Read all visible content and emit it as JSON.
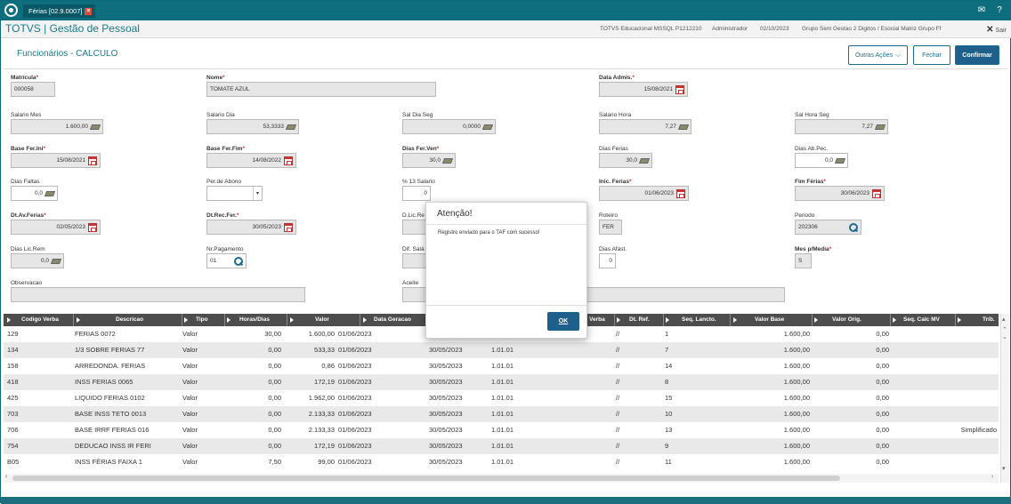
{
  "titlebar": {
    "tab_label": "Férias [02.9.0007]",
    "tab_close": "×",
    "mail_icon": "✉",
    "help_icon": "?"
  },
  "header": {
    "brand": "TOTVS | Gestão de Pessoal",
    "environment": "TOTVS Educacional MSSQL P1212210",
    "user": "Administrador",
    "date": "02/10/2023",
    "company": "Grupo Sem Gestao 2 Digitos / Esocial Matriz Grupo Ff",
    "exit_label": "Sair",
    "exit_icon": "✕"
  },
  "page": {
    "title": "Funcionários - CALCULO",
    "other_actions": "Outras Ações",
    "close": "Fechar",
    "confirm": "Confirmar"
  },
  "form": {
    "matricula": {
      "label": "Matrícula",
      "value": "000058"
    },
    "nome": {
      "label": "Nome",
      "value": "TOMATE AZUL"
    },
    "data_adms": {
      "label": "Data Admis.",
      "value": "15/08/2021"
    },
    "salario_mes": {
      "label": "Salario Mes",
      "value": "1.600,00"
    },
    "salario_dia": {
      "label": "Salario Dia",
      "value": "53,3333"
    },
    "sal_dia_seg": {
      "label": "Sal Dia Seg",
      "value": "0,0000"
    },
    "salario_hora": {
      "label": "Salario Hora",
      "value": "7,27"
    },
    "sal_hora_seg": {
      "label": "Sal Hora Seg",
      "value": "7,27"
    },
    "base_fer_ini": {
      "label": "Base Fer.Ini",
      "value": "15/08/2021"
    },
    "base_fer_fim": {
      "label": "Base Fer.Fim",
      "value": "14/08/2022"
    },
    "dias_fer_ven": {
      "label": "Dias Fer.Ven",
      "value": "30,0"
    },
    "dias_ferias": {
      "label": "Dias Ferias",
      "value": "30,0"
    },
    "dias_ab_pec": {
      "label": "Dias Ab.Pec.",
      "value": "0,0"
    },
    "dias_faltas": {
      "label": "Dias Faltas",
      "value": "0,0"
    },
    "per_abono": {
      "label": "Per.de Abono",
      "value": ""
    },
    "pct_13_salario": {
      "label": "% 13 Salario",
      "value": "0"
    },
    "inic_ferias": {
      "label": "Inic. Ferias",
      "value": "01/06/2023"
    },
    "fim_ferias": {
      "label": "Fim  Férias",
      "value": "30/06/2023"
    },
    "dt_av_ferias": {
      "label": "Dt.Av.Ferias",
      "value": "02/05/2023"
    },
    "dt_rec_fer": {
      "label": "Dt.Rec.Fer.",
      "value": "30/05/2023"
    },
    "d_lic_re": {
      "label": "D.Lic.Re"
    },
    "roteiro": {
      "label": "Roteiro",
      "value": "FER"
    },
    "periodo": {
      "label": "Periodo",
      "value": "202306"
    },
    "dias_lic_rem": {
      "label": "Dias Lic.Rem",
      "value": "0,0"
    },
    "nr_pagamento": {
      "label": "Nr.Pagamento",
      "value": "01"
    },
    "dif_sal": {
      "label": "Dif. Salá"
    },
    "dias_afast": {
      "label": "Dias Afast.",
      "value": "0"
    },
    "mes_p_media": {
      "label": "Mes p/Media",
      "value": "S"
    },
    "observacao": {
      "label": "Observacao",
      "value": ""
    },
    "aceite": {
      "label": "Aceite",
      "value": ""
    }
  },
  "grid": {
    "headers": [
      "Codigo Verba",
      "Descricao",
      "Tipo",
      "Horas/Dias",
      "Valor",
      "Data Geracao",
      "Verba",
      "Dt. Ref.",
      "Seq. Lancto.",
      "Valor Base",
      "Valor Orig.",
      "Seq. Calc MV",
      "Trib."
    ],
    "rows": [
      [
        "129",
        "FERIAS 0072",
        "Valor",
        "30,00",
        "1.600,00",
        "01/06/2023",
        "",
        "",
        "//",
        "1",
        "1.600,00",
        "0,00",
        ""
      ],
      [
        "134",
        "1/3 SOBRE FERIAS 77",
        "Valor",
        "0,00",
        "533,33",
        "01/06/2023",
        "30/05/2023",
        "1.01.01",
        "//",
        "7",
        "1.600,00",
        "0,00",
        ""
      ],
      [
        "158",
        "ARREDONDA. FERIAS",
        "Valor",
        "0,00",
        "0,86",
        "01/06/2023",
        "30/05/2023",
        "1.01.01",
        "//",
        "14",
        "1.600,00",
        "0,00",
        ""
      ],
      [
        "418",
        "INSS FERIAS 0065",
        "Valor",
        "0,00",
        "172,19",
        "01/06/2023",
        "30/05/2023",
        "1.01.01",
        "//",
        "8",
        "1.600,00",
        "0,00",
        ""
      ],
      [
        "425",
        "LIQUIDO FERIAS 0102",
        "Valor",
        "0,00",
        "1.962,00",
        "01/06/2023",
        "30/05/2023",
        "1.01.01",
        "//",
        "15",
        "1.600,00",
        "0,00",
        ""
      ],
      [
        "703",
        "BASE INSS TETO 0013",
        "Valor",
        "0,00",
        "2.133,33",
        "01/06/2023",
        "30/05/2023",
        "1.01.01",
        "//",
        "10",
        "1.600,00",
        "0,00",
        ""
      ],
      [
        "706",
        "BASE IRRF FERIAS 016",
        "Valor",
        "0,00",
        "2.133,33",
        "01/06/2023",
        "30/05/2023",
        "1.01.01",
        "//",
        "13",
        "1.600,00",
        "0,00",
        "Simplificado"
      ],
      [
        "754",
        "DEDUCAO INSS IR FERI",
        "Valor",
        "0,00",
        "172,19",
        "01/06/2023",
        "30/05/2023",
        "1.01.01",
        "//",
        "9",
        "1.600,00",
        "0,00",
        ""
      ],
      [
        "B05",
        "INSS FÉRIAS FAIXA 1",
        "Valor",
        "7,50",
        "99,00",
        "01/06/2023",
        "30/05/2023",
        "1.01.01",
        "//",
        "11",
        "1.600,00",
        "0,00",
        ""
      ]
    ]
  },
  "modal": {
    "title": "Atenção!",
    "message": "Registro enviado para o TAF com sucesso!",
    "ok": "OK"
  }
}
